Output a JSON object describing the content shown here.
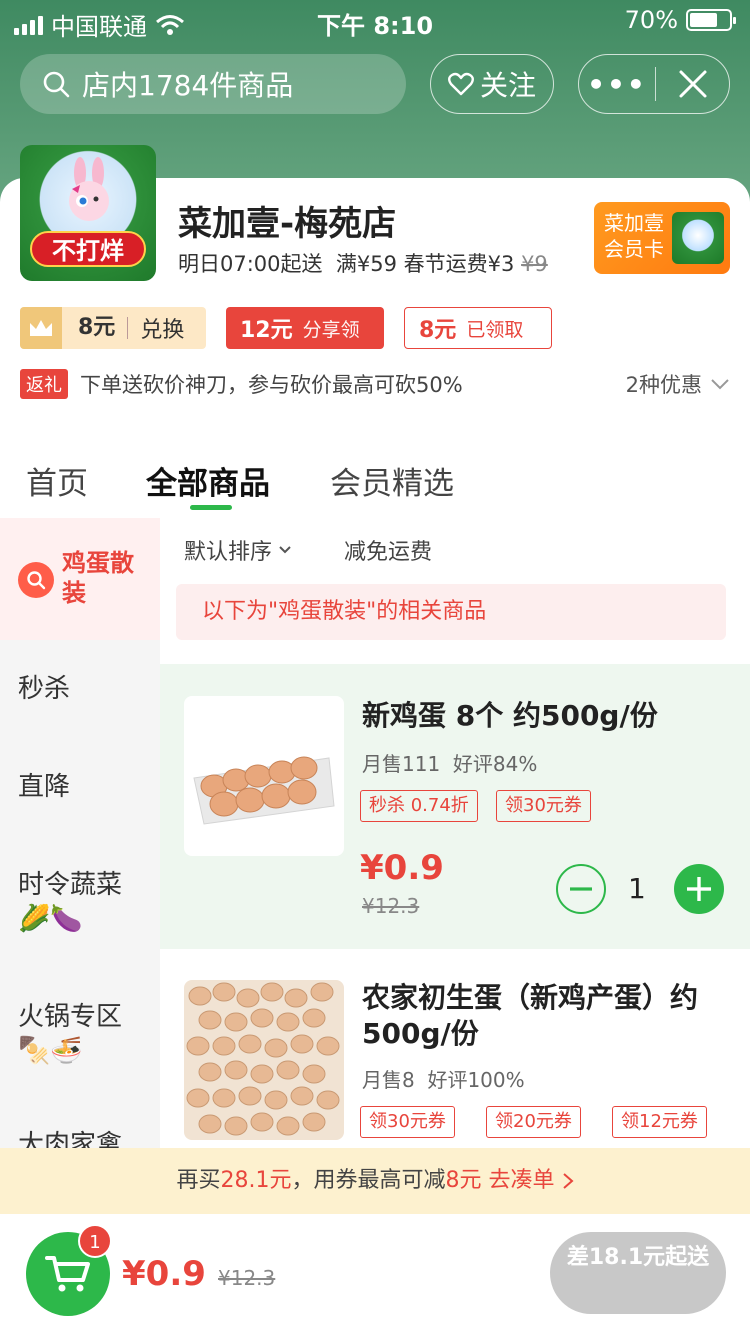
{
  "status_bar": {
    "carrier": "中国联通",
    "time": "下午 8:10",
    "battery": "70%",
    "battery_level": 0.7
  },
  "header": {
    "search_placeholder": "店内1784件商品",
    "follow_label": "关注",
    "more_label": "•••"
  },
  "store": {
    "logo_text": "不打烊",
    "name": "菜加壹-梅苑店",
    "delivery_time": "明日07:00起送",
    "fee_prefix": "满¥59 春节运费¥3",
    "fee_original": "¥9",
    "member_card_line1": "菜加壹",
    "member_card_line2": "会员卡"
  },
  "coupons": [
    {
      "amount": "8元",
      "action": "兑换"
    },
    {
      "amount": "12元",
      "action": "分享领"
    },
    {
      "amount": "8元",
      "action": "已领取"
    }
  ],
  "promo": {
    "badge": "返礼",
    "text": "下单送砍价神刀，参与砍价最高可砍50%",
    "more": "2种优惠"
  },
  "tabs": [
    "首页",
    "全部商品",
    "会员精选"
  ],
  "sidebar": {
    "active": "鸡蛋散装",
    "items": [
      {
        "label": "秒杀",
        "emoji": ""
      },
      {
        "label": "直降",
        "emoji": ""
      },
      {
        "label": "时令蔬菜",
        "emoji": "🌽🍆"
      },
      {
        "label": "火锅专区",
        "emoji": "🍢🍜"
      },
      {
        "label": "大肉家禽",
        "emoji": ""
      }
    ]
  },
  "filters": {
    "sort": "默认排序",
    "free_shipping": "减免运费"
  },
  "notice": "以下为\"鸡蛋散装\"的相关商品",
  "products": [
    {
      "name": "新鸡蛋 8个 约500g/份",
      "monthly_sales": "月售111",
      "rating": "好评84%",
      "tags": [
        "秒杀 0.74折",
        "领30元券"
      ],
      "price": "¥0.9",
      "original_price": "¥12.3",
      "quantity": "1"
    },
    {
      "name": "农家初生蛋（新鸡产蛋）约500g/份",
      "monthly_sales": "月售8",
      "rating": "好评100%",
      "tags": [
        "领30元券",
        "领20元券",
        "领12元券"
      ]
    }
  ],
  "hint": {
    "prefix": "再买",
    "amount": "28.1元",
    "middle": "，用券最高可减",
    "discount": "8元",
    "link": "去凑单"
  },
  "cart": {
    "badge": "1",
    "total": "¥0.9",
    "original_total": "¥12.3",
    "checkout": "差18.1元起送"
  },
  "colors": {
    "brand_green": "#2db84a",
    "accent_red": "#e8453c",
    "header_green": "#4a9168"
  }
}
